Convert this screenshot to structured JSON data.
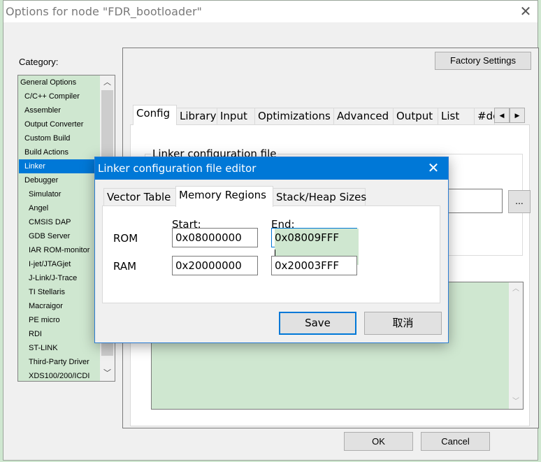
{
  "options_dialog": {
    "title": "Options for node \"FDR_bootloader\"",
    "close_glyph": "✕",
    "category_label": "Category:",
    "categories": [
      {
        "label": "General Options",
        "level": 0,
        "selected": false
      },
      {
        "label": "C/C++ Compiler",
        "level": 1,
        "selected": false
      },
      {
        "label": "Assembler",
        "level": 1,
        "selected": false
      },
      {
        "label": "Output Converter",
        "level": 1,
        "selected": false
      },
      {
        "label": "Custom Build",
        "level": 1,
        "selected": false
      },
      {
        "label": "Build Actions",
        "level": 1,
        "selected": false
      },
      {
        "label": "Linker",
        "level": 1,
        "selected": true
      },
      {
        "label": "Debugger",
        "level": 1,
        "selected": false
      },
      {
        "label": "Simulator",
        "level": 2,
        "selected": false
      },
      {
        "label": "Angel",
        "level": 2,
        "selected": false
      },
      {
        "label": "CMSIS DAP",
        "level": 2,
        "selected": false
      },
      {
        "label": "GDB Server",
        "level": 2,
        "selected": false
      },
      {
        "label": "IAR ROM-monitor",
        "level": 2,
        "selected": false
      },
      {
        "label": "I-jet/JTAGjet",
        "level": 2,
        "selected": false
      },
      {
        "label": "J-Link/J-Trace",
        "level": 2,
        "selected": false
      },
      {
        "label": "TI Stellaris",
        "level": 2,
        "selected": false
      },
      {
        "label": "Macraigor",
        "level": 2,
        "selected": false
      },
      {
        "label": "PE micro",
        "level": 2,
        "selected": false
      },
      {
        "label": "RDI",
        "level": 2,
        "selected": false
      },
      {
        "label": "ST-LINK",
        "level": 2,
        "selected": false
      },
      {
        "label": "Third-Party Driver",
        "level": 2,
        "selected": false
      },
      {
        "label": "XDS100/200/ICDI",
        "level": 2,
        "selected": false
      }
    ],
    "scroll_up_glyph": "︿",
    "scroll_down_glyph": "﹀",
    "factory_settings_label": "Factory Settings",
    "tabs": [
      {
        "label": "Config",
        "active": true
      },
      {
        "label": "Library",
        "active": false
      },
      {
        "label": "Input",
        "active": false
      },
      {
        "label": "Optimizations",
        "active": false
      },
      {
        "label": "Advanced",
        "active": false
      },
      {
        "label": "Output",
        "active": false
      },
      {
        "label": "List",
        "active": false
      },
      {
        "label": "#de",
        "active": false
      }
    ],
    "tab_scroll_left_glyph": "◀",
    "tab_scroll_right_glyph": "▶",
    "linker_cfg_group_title": "Linker configuration file",
    "browse_label": "...",
    "ok_label": "OK",
    "cancel_label": "Cancel"
  },
  "editor_dialog": {
    "title": "Linker configuration file editor",
    "close_glyph": "✕",
    "tabs": [
      {
        "label": "Vector Table",
        "active": false
      },
      {
        "label": "Memory Regions",
        "active": true
      },
      {
        "label": "Stack/Heap Sizes",
        "active": false
      }
    ],
    "start_label": "Start:",
    "end_label": "End:",
    "regions": [
      {
        "name": "ROM",
        "start": "0x08000000",
        "end": "0x08009FFF"
      },
      {
        "name": "RAM",
        "start": "0x20000000",
        "end": "0x20003FFF"
      }
    ],
    "save_label": "Save",
    "cancel_label": "取消"
  }
}
